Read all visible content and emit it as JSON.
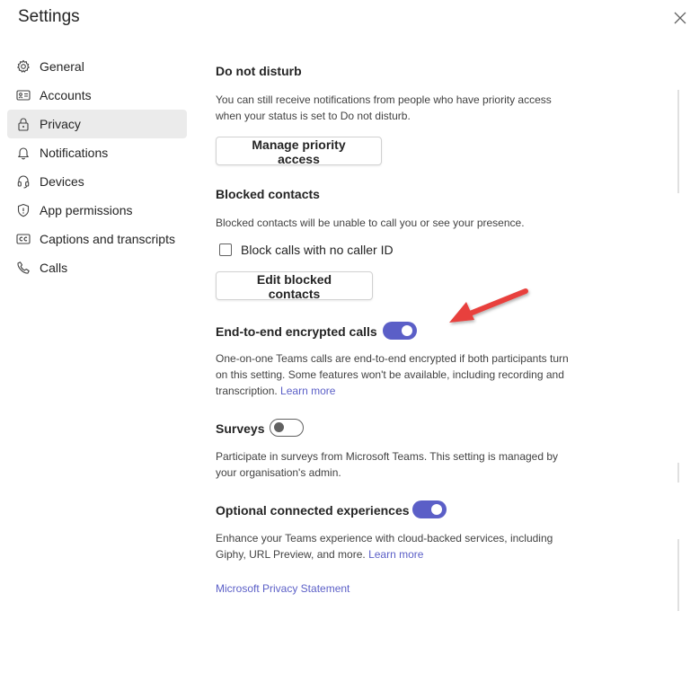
{
  "dialog": {
    "title": "Settings",
    "close_icon": "close-icon"
  },
  "nav": {
    "items": [
      {
        "label": "General",
        "icon": "gear-icon"
      },
      {
        "label": "Accounts",
        "icon": "id-card-icon"
      },
      {
        "label": "Privacy",
        "icon": "lock-icon",
        "active": true
      },
      {
        "label": "Notifications",
        "icon": "bell-icon"
      },
      {
        "label": "Devices",
        "icon": "headset-icon"
      },
      {
        "label": "App permissions",
        "icon": "shield-icon"
      },
      {
        "label": "Captions and transcripts",
        "icon": "cc-icon"
      },
      {
        "label": "Calls",
        "icon": "phone-icon"
      }
    ]
  },
  "privacy": {
    "dnd": {
      "heading": "Do not disturb",
      "desc_line1": "You can still receive notifications from people who have priority access",
      "desc_line2": "when your status is set to Do not disturb.",
      "button": "Manage priority access"
    },
    "blocked": {
      "heading": "Blocked contacts",
      "desc": "Blocked contacts will be unable to call you or see your presence.",
      "checkbox_label": "Block calls with no caller ID",
      "checkbox_checked": false,
      "button": "Edit blocked contacts"
    },
    "e2e": {
      "heading": "End-to-end encrypted calls",
      "toggle_on": true,
      "desc_line1": "One-on-one Teams calls are end-to-end encrypted if both participants turn",
      "desc_line2": "on this setting. Some features won't be available, including recording and",
      "desc_line3": "transcription.",
      "link": "Learn more"
    },
    "surveys": {
      "heading": "Surveys",
      "toggle_on": false,
      "desc_line1": "Participate in surveys from Microsoft Teams. This setting is managed by",
      "desc_line2": "your organisation's admin."
    },
    "optional": {
      "heading": "Optional connected experiences",
      "toggle_on": true,
      "desc_line1": "Enhance your Teams experience with cloud-backed services, including",
      "desc_line2": "Giphy, URL Preview, and more.",
      "link": "Learn more"
    },
    "privacy_statement": "Microsoft Privacy Statement"
  },
  "colors": {
    "accent": "#5b5fc7",
    "annotation_arrow": "#e8403c",
    "active_nav_bg": "#ebebeb"
  }
}
